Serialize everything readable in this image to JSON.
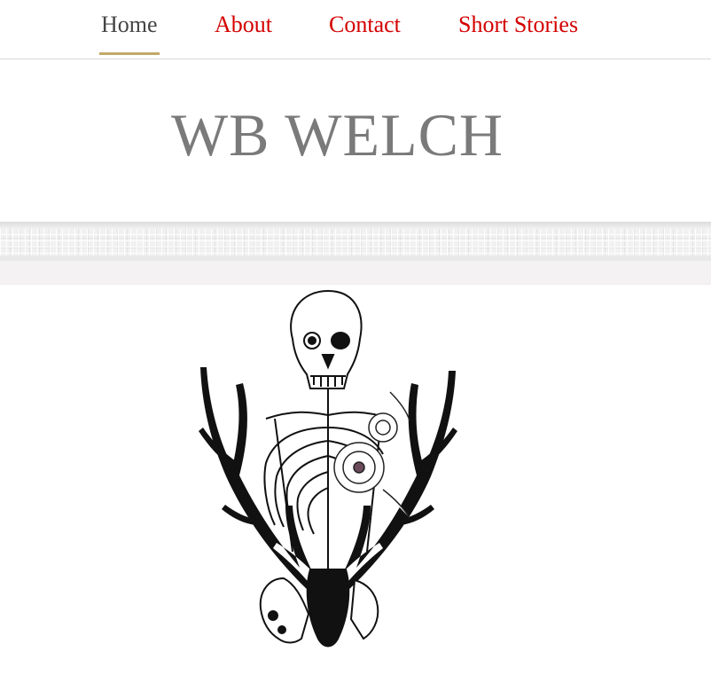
{
  "nav": {
    "items": [
      {
        "label": "Home",
        "active": true
      },
      {
        "label": "About",
        "active": false
      },
      {
        "label": "Contact",
        "active": false
      },
      {
        "label": "Short Stories",
        "active": false
      }
    ],
    "active_color": "#444444",
    "link_color": "#d40000",
    "underline_color": "#c2a968"
  },
  "header": {
    "title": "WB WELCH",
    "title_color": "#7a7a7a"
  },
  "hero": {
    "image": "skeleton-antlers-flowers-illustration"
  }
}
